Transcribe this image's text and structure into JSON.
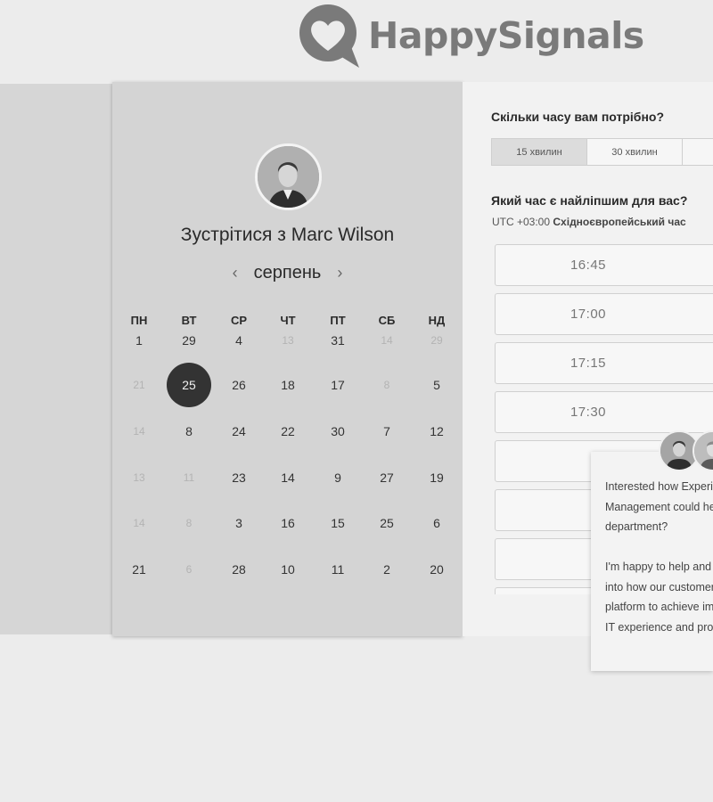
{
  "brand": {
    "name": "HappySignals",
    "logo_color": "#7a7a7a"
  },
  "booking": {
    "meet_title": "Зустрітися з Marc Wilson",
    "month": "серпень",
    "weekdays": [
      "ПН",
      "ВТ",
      "СР",
      "ЧТ",
      "ПТ",
      "СБ",
      "НД"
    ],
    "weeks": [
      [
        {
          "d": "1"
        },
        {
          "d": "29"
        },
        {
          "d": "4"
        },
        {
          "d": "13",
          "m": true
        },
        {
          "d": "31"
        },
        {
          "d": "14",
          "m": true
        },
        {
          "d": "29",
          "m": true
        }
      ],
      [
        {
          "d": "21",
          "m": true
        },
        {
          "d": "25",
          "s": true
        },
        {
          "d": "26"
        },
        {
          "d": "18"
        },
        {
          "d": "17"
        },
        {
          "d": "8",
          "m": true
        },
        {
          "d": "5"
        }
      ],
      [
        {
          "d": "14",
          "m": true
        },
        {
          "d": "8"
        },
        {
          "d": "24"
        },
        {
          "d": "22"
        },
        {
          "d": "30"
        },
        {
          "d": "7"
        },
        {
          "d": "12"
        }
      ],
      [
        {
          "d": "13",
          "m": true
        },
        {
          "d": "11",
          "m": true
        },
        {
          "d": "23"
        },
        {
          "d": "14"
        },
        {
          "d": "9"
        },
        {
          "d": "27"
        },
        {
          "d": "19"
        }
      ],
      [
        {
          "d": "14",
          "m": true
        },
        {
          "d": "8",
          "m": true
        },
        {
          "d": "3"
        },
        {
          "d": "16"
        },
        {
          "d": "15"
        },
        {
          "d": "25"
        },
        {
          "d": "6"
        }
      ],
      [
        {
          "d": "21"
        },
        {
          "d": "6",
          "m": true
        },
        {
          "d": "28"
        },
        {
          "d": "10"
        },
        {
          "d": "11"
        },
        {
          "d": "2"
        },
        {
          "d": "20"
        }
      ]
    ],
    "duration_question": "Скільки часу вам потрібно?",
    "durations": [
      "15 хвилин",
      "30 хвилин",
      ""
    ],
    "selected_duration": "15 хвилин",
    "time_question": "Який час є найліпшим для вас?",
    "timezone_offset": "UTC +03:00",
    "timezone_name": "Східноєвропейський час",
    "slots": [
      "16:45",
      "17:00",
      "17:15",
      "17:30",
      "",
      "",
      "",
      ""
    ]
  },
  "chat": {
    "message": "Interested how Experience Management could help your department?\n\nI'm happy to help and give insight into how our customers use our platform to achieve improvement in IT experience and productivity."
  }
}
